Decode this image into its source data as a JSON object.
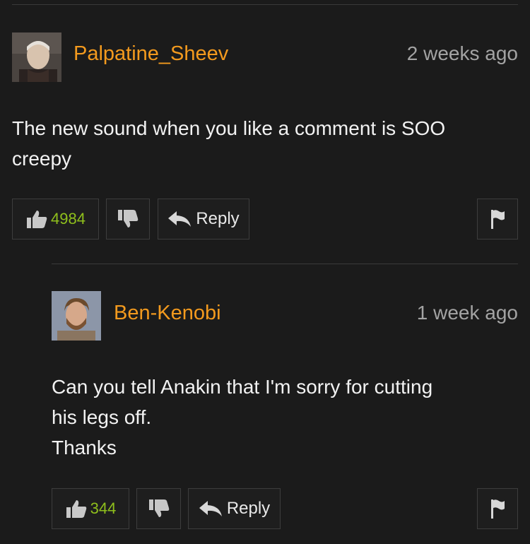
{
  "comments": [
    {
      "username": "Palpatine_Sheev",
      "timestamp": "2 weeks ago",
      "text": "The new sound when you like a comment is SOO\ncreepy",
      "likes": "4984",
      "reply_label": "Reply",
      "avatar_icon": "user-avatar-palpatine"
    },
    {
      "username": "Ben-Kenobi",
      "timestamp": "1 week ago",
      "text": "Can you tell Anakin that I'm sorry for cutting\nhis legs off.\nThanks",
      "likes": "344",
      "reply_label": "Reply",
      "avatar_icon": "user-avatar-kenobi"
    }
  ],
  "colors": {
    "background": "#1b1b1b",
    "username": "#f39a1e",
    "like_count": "#8fbf1c",
    "timestamp": "#a3a3a3"
  }
}
